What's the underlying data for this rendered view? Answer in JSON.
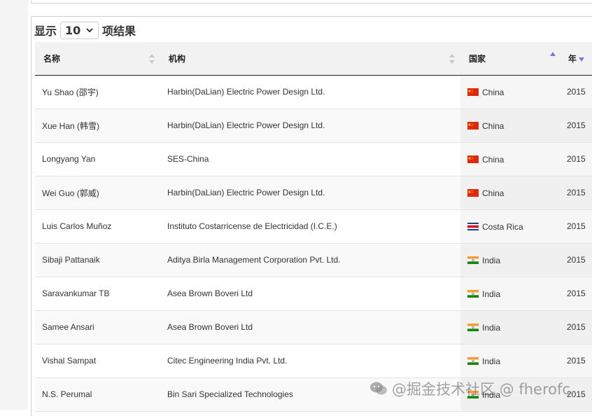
{
  "length_menu": {
    "prefix": "显示",
    "value": "10",
    "suffix": "项结果"
  },
  "columns": [
    {
      "label": "名称"
    },
    {
      "label": "机构"
    },
    {
      "label": "国家"
    },
    {
      "label": "年"
    }
  ],
  "rows": [
    {
      "name": "Yu Shao (邵宇)",
      "org": "Harbin(DaLian) Electric Power Design Ltd.",
      "country": "China",
      "flag": "china-flag-icon",
      "year": "2015"
    },
    {
      "name": "Xue Han (韩雪)",
      "org": "Harbin(DaLian) Electric Power Design Ltd.",
      "country": "China",
      "flag": "china-flag-icon",
      "year": "2015"
    },
    {
      "name": "Longyang Yan",
      "org": "SES-China",
      "country": "China",
      "flag": "china-flag-icon",
      "year": "2015"
    },
    {
      "name": "Wei Guo (郭威)",
      "org": "Harbin(DaLian) Electric Power Design Ltd.",
      "country": "China",
      "flag": "china-flag-icon",
      "year": "2015"
    },
    {
      "name": "Luis Carlos Muñoz",
      "org": "Instituto Costarricense de Electricidad (I.C.E.)",
      "country": "Costa Rica",
      "flag": "costa-rica-flag-icon",
      "year": "2015"
    },
    {
      "name": "Sibaji Pattanaik",
      "org": "Aditya Birla Management Corporation Pvt. Ltd.",
      "country": "India",
      "flag": "india-flag-icon",
      "year": "2015"
    },
    {
      "name": "Saravankumar TB",
      "org": "Asea Brown Boveri Ltd",
      "country": "India",
      "flag": "india-flag-icon",
      "year": "2015"
    },
    {
      "name": "Samee Ansari",
      "org": "Asea Brown Boveri Ltd",
      "country": "India",
      "flag": "india-flag-icon",
      "year": "2015"
    },
    {
      "name": "Vishal Sampat",
      "org": "Citec Engineering India Pvt. Ltd.",
      "country": "India",
      "flag": "india-flag-icon",
      "year": "2015"
    },
    {
      "name": "N.S. Perumal",
      "org": "Bin Sari Specialized Technologies",
      "country": "India",
      "flag": "india-flag-icon",
      "year": "2015"
    }
  ],
  "watermark": "@掘金技术社区 @ fherofc",
  "colors": {
    "sort_active": "#7b78e0",
    "sort_inactive": "#c8c8c8",
    "header_bg": "#f2f2f2",
    "header_border": "#222222"
  }
}
